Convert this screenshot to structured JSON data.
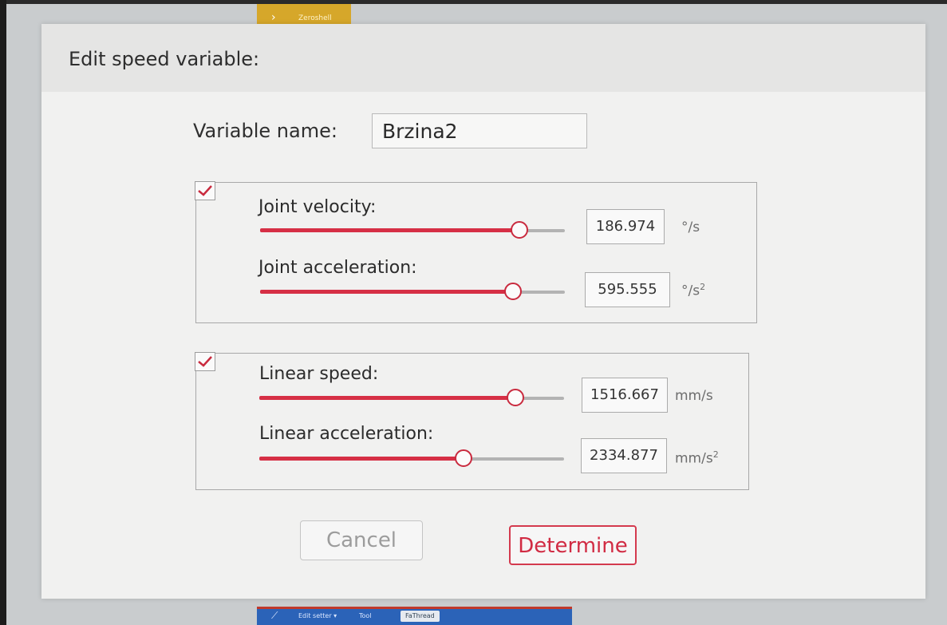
{
  "background": {
    "top_strip_label": "Zeroshell",
    "bottom_strip": {
      "item1": "Edit setter ▾",
      "item2": "Tool",
      "item3": "FaThread"
    }
  },
  "dialog": {
    "title": "Edit speed variable:",
    "variable_name_label": "Variable name:",
    "variable_name_value": "Brzina2",
    "joint_group": {
      "checked": true,
      "velocity": {
        "label": "Joint velocity:",
        "value": "186.974",
        "unit": "°/s",
        "slider_fraction": 0.85
      },
      "acceleration": {
        "label": "Joint acceleration:",
        "value": "595.555",
        "unit_base": "°/s",
        "unit_sup": "2",
        "slider_fraction": 0.83
      }
    },
    "linear_group": {
      "checked": true,
      "speed": {
        "label": "Linear speed:",
        "value": "1516.667",
        "unit": "mm/s",
        "slider_fraction": 0.84
      },
      "acceleration": {
        "label": "Linear acceleration:",
        "value": "2334.877",
        "unit_base": "mm/s",
        "unit_sup": "2",
        "slider_fraction": 0.67
      }
    },
    "cancel_label": "Cancel",
    "determine_label": "Determine"
  },
  "colors": {
    "accent": "#d62f45",
    "track": "#b3b3b3",
    "dialog_bg": "#f1f1f0"
  }
}
